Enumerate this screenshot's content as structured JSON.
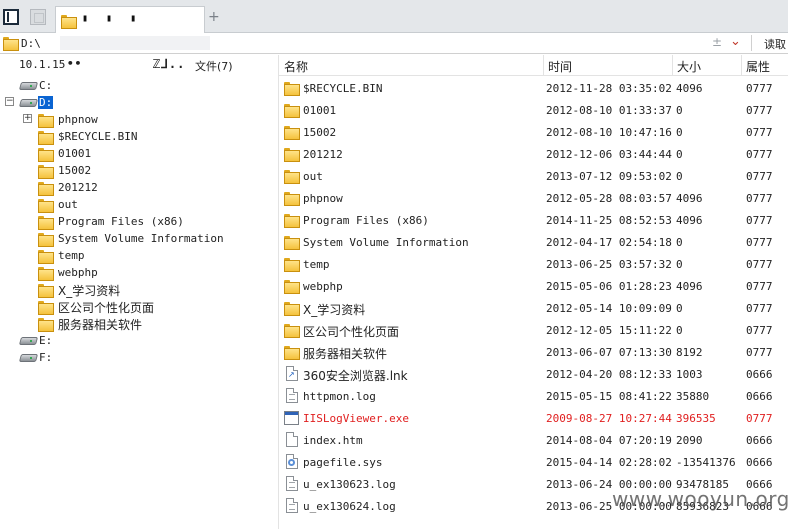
{
  "tab_bar": {
    "tab_label": "▮ ▮ ▮",
    "new_tab": "+"
  },
  "address": {
    "path": "D:\\",
    "plus": "±",
    "dropdown": "⌄",
    "read_button": "读取"
  },
  "left_header": {
    "ip": "10.1.15",
    "dots": "••",
    "code": "ℤ⅃..",
    "files": "文件(7)"
  },
  "tree": {
    "expand": "+",
    "collapse": "−",
    "c_drive": "C:",
    "d_drive": "D:",
    "e_drive": "E:",
    "f_drive": "F:",
    "folders": [
      "phpnow",
      "$RECYCLE.BIN",
      "01001",
      "15002",
      "201212",
      "out",
      "Program Files (x86)",
      "System Volume Information",
      "temp",
      "webphp",
      "X_学习资料",
      "区公司个性化页面",
      "服务器相关软件"
    ]
  },
  "columns": {
    "name": "名称",
    "time": "时间",
    "size": "大小",
    "attr": "属性"
  },
  "rows": [
    {
      "name": "$RECYCLE.BIN",
      "time": "2012-11-28 03:35:02",
      "size": "4096",
      "attr": "0777",
      "icon": "folder-icon"
    },
    {
      "name": "01001",
      "time": "2012-08-10 01:33:37",
      "size": "0",
      "attr": "0777",
      "icon": "folder-icon"
    },
    {
      "name": "15002",
      "time": "2012-08-10 10:47:16",
      "size": "0",
      "attr": "0777",
      "icon": "folder-icon"
    },
    {
      "name": "201212",
      "time": "2012-12-06 03:44:44",
      "size": "0",
      "attr": "0777",
      "icon": "folder-icon"
    },
    {
      "name": "out",
      "time": "2013-07-12 09:53:02",
      "size": "0",
      "attr": "0777",
      "icon": "folder-icon"
    },
    {
      "name": "phpnow",
      "time": "2012-05-28 08:03:57",
      "size": "4096",
      "attr": "0777",
      "icon": "folder-icon"
    },
    {
      "name": "Program Files (x86)",
      "time": "2014-11-25 08:52:53",
      "size": "4096",
      "attr": "0777",
      "icon": "folder-icon"
    },
    {
      "name": "System Volume Information",
      "time": "2012-04-17 02:54:18",
      "size": "0",
      "attr": "0777",
      "icon": "folder-icon"
    },
    {
      "name": "temp",
      "time": "2013-06-25 03:57:32",
      "size": "0",
      "attr": "0777",
      "icon": "folder-icon"
    },
    {
      "name": "webphp",
      "time": "2015-05-06 01:28:23",
      "size": "4096",
      "attr": "0777",
      "icon": "folder-icon"
    },
    {
      "name": "X_学习资料",
      "time": "2012-05-14 10:09:09",
      "size": "0",
      "attr": "0777",
      "icon": "folder-icon"
    },
    {
      "name": "区公司个性化页面",
      "time": "2012-12-05 15:11:22",
      "size": "0",
      "attr": "0777",
      "icon": "folder-icon"
    },
    {
      "name": "服务器相关软件",
      "time": "2013-06-07 07:13:30",
      "size": "8192",
      "attr": "0777",
      "icon": "folder-icon"
    },
    {
      "name": "360安全浏览器.lnk",
      "time": "2012-04-20 08:12:33",
      "size": "1003",
      "attr": "0666",
      "icon": "shortcut-icon"
    },
    {
      "name": "httpmon.log",
      "time": "2015-05-15 08:41:22",
      "size": "35880",
      "attr": "0666",
      "icon": "text-file-icon"
    },
    {
      "name": "IISLogViewer.exe",
      "time": "2009-08-27 10:27:44",
      "size": "396535",
      "attr": "0777",
      "icon": "exe-icon",
      "highlight": true
    },
    {
      "name": "index.htm",
      "time": "2014-08-04 07:20:19",
      "size": "2090",
      "attr": "0666",
      "icon": "file-icon"
    },
    {
      "name": "pagefile.sys",
      "time": "2015-04-14 02:28:02",
      "size": "-13541376",
      "attr": "0666",
      "icon": "system-file-icon"
    },
    {
      "name": "u_ex130623.log",
      "time": "2013-06-24 00:00:00",
      "size": "93478185",
      "attr": "0666",
      "icon": "text-file-icon"
    },
    {
      "name": "u_ex130624.log",
      "time": "2013-06-25 00:00:00",
      "size": "85936823",
      "attr": "0666",
      "icon": "text-file-icon"
    }
  ],
  "watermark": "www.wooyun.org",
  "colors": {
    "selected": "#0a64d2",
    "highlight_row": "#e02020",
    "folder": "#f5c23c"
  }
}
